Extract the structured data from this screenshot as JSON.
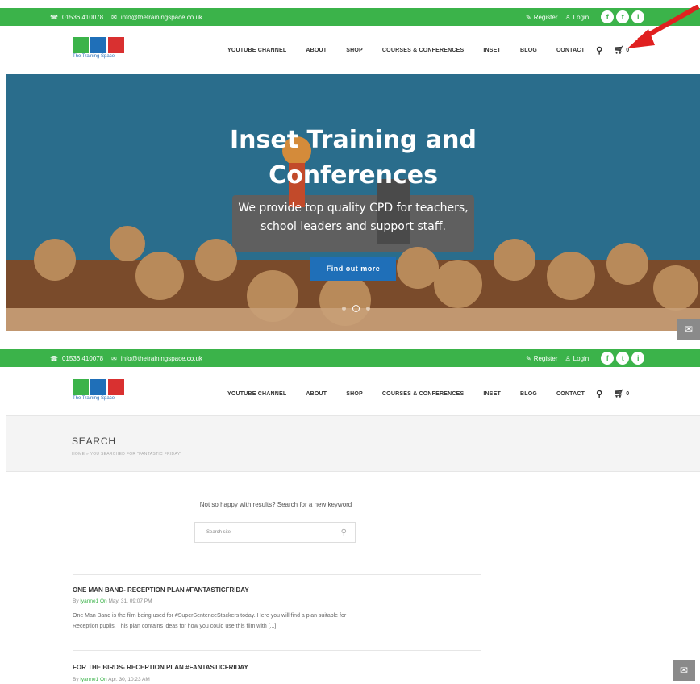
{
  "topbar": {
    "phone": "01536 410078",
    "email": "info@thetrainingspace.co.uk",
    "register": "Register",
    "login": "Login",
    "social": [
      "f",
      "t",
      "i"
    ]
  },
  "logo": {
    "text": "The Training Space",
    "colors": [
      "#3bb34a",
      "#1f6fb8",
      "#d93030"
    ]
  },
  "nav": {
    "items": [
      "YOUTUBE CHANNEL",
      "ABOUT",
      "SHOP",
      "COURSES & CONFERENCES",
      "INSET",
      "BLOG",
      "CONTACT"
    ],
    "cart_count": "0"
  },
  "hero": {
    "title_line1": "Inset Training and",
    "title_line2": "Conferences",
    "sub_line1": "We provide top quality CPD for teachers,",
    "sub_line2": "school leaders and support staff.",
    "button": "Find out more"
  },
  "search_page": {
    "title": "SEARCH",
    "breadcrumb": "HOME » YOU SEARCHED FOR \"FANTASTIC FRIDAY\"",
    "retry_text": "Not so happy with results? Search for a new keyword",
    "search_placeholder": "Search site"
  },
  "results": [
    {
      "title": "ONE MAN BAND- RECEPTION PLAN #FANTASTICFRIDAY",
      "by": "By",
      "author": "lyanne1",
      "on": "On",
      "date": "May. 31, 09:07 PM",
      "excerpt_line1": "One Man Band  is the film being used for #SuperSentenceStackers today. Here you will find a plan suitable for",
      "excerpt_line2": "Reception pupils. This plan contains ideas for how you could use this film with [...]"
    },
    {
      "title": "FOR THE BIRDS- RECEPTION PLAN #FANTASTICFRIDAY",
      "by": "By",
      "author": "lyanne1",
      "on": "On",
      "date": "Apr. 30, 10:23 AM"
    }
  ],
  "colors": {
    "green": "#3bb34a",
    "blue": "#1f6fb8",
    "hero_bg": "#2a6d8c",
    "arrow": "#e02020"
  }
}
